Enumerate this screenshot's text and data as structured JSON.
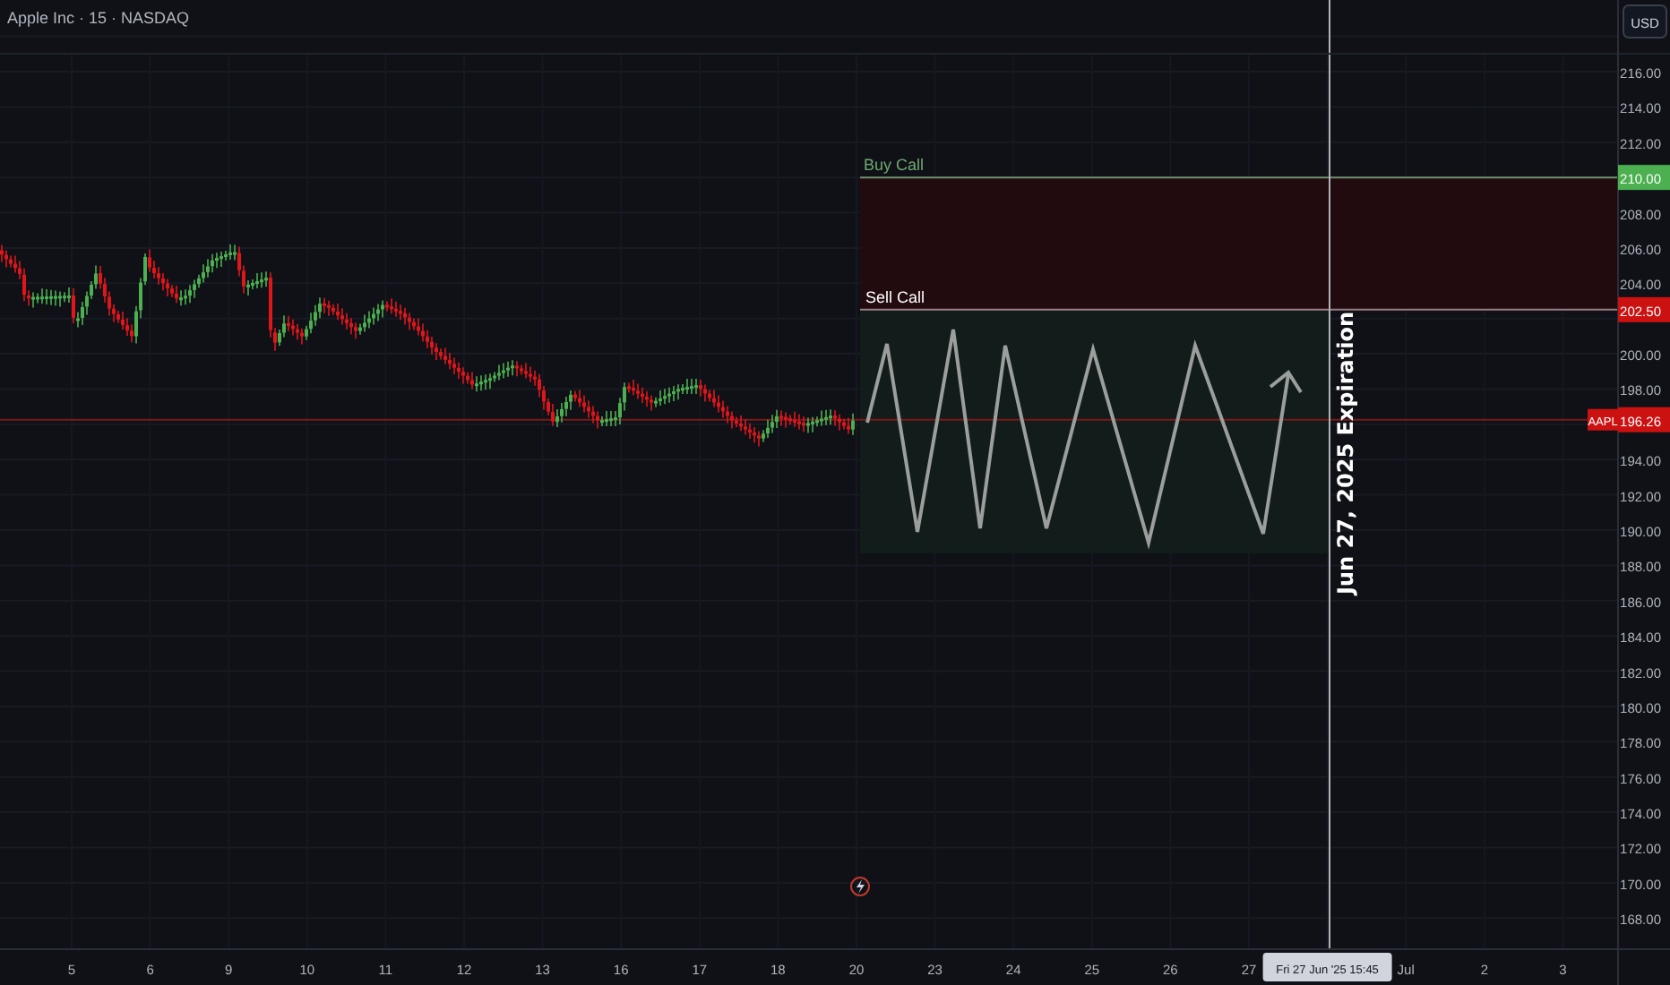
{
  "header": {
    "title": "Apple Inc · 15 · NASDAQ"
  },
  "price_axis": {
    "currency_button": "USD",
    "labels": [
      "216.00",
      "214.00",
      "212.00",
      "208.00",
      "206.00",
      "204.00",
      "200.00",
      "198.00",
      "194.00",
      "192.00",
      "190.00",
      "188.00",
      "186.00",
      "184.00",
      "182.00",
      "180.00",
      "178.00",
      "176.00",
      "174.00",
      "172.00",
      "170.00",
      "168.00"
    ],
    "tags": [
      {
        "value": "210.00",
        "color": "#4caf50"
      },
      {
        "value": "202.50",
        "color": "#cc1111"
      },
      {
        "symbol": "AAPL",
        "value": "196.26",
        "color": "#cc1111"
      }
    ]
  },
  "drawings": {
    "buy_call_label": "Buy Call",
    "sell_call_label": "Sell Call",
    "expiration_label": "Jun 27, 2025 Expiration"
  },
  "time_axis": [
    {
      "kind": "tick",
      "label": "5"
    },
    {
      "kind": "tick",
      "label": "6"
    },
    {
      "kind": "tick",
      "label": "9"
    },
    {
      "kind": "tick",
      "label": "10"
    },
    {
      "kind": "tick",
      "label": "11"
    },
    {
      "kind": "tick",
      "label": "12"
    },
    {
      "kind": "tick",
      "label": "13"
    },
    {
      "kind": "tick",
      "label": "16"
    },
    {
      "kind": "tick",
      "label": "17"
    },
    {
      "kind": "tick",
      "label": "18"
    },
    {
      "kind": "tick",
      "label": "20"
    },
    {
      "kind": "tick",
      "label": "23"
    },
    {
      "kind": "tick",
      "label": "24"
    },
    {
      "kind": "tick",
      "label": "25"
    },
    {
      "kind": "tick",
      "label": "26"
    },
    {
      "kind": "tick",
      "label": "27"
    },
    {
      "kind": "crosshair",
      "label": "Fri 27 Jun '25   15:45"
    },
    {
      "kind": "tick",
      "label": "Jul"
    },
    {
      "kind": "tick",
      "label": "2"
    },
    {
      "kind": "tick",
      "label": "3"
    }
  ]
}
